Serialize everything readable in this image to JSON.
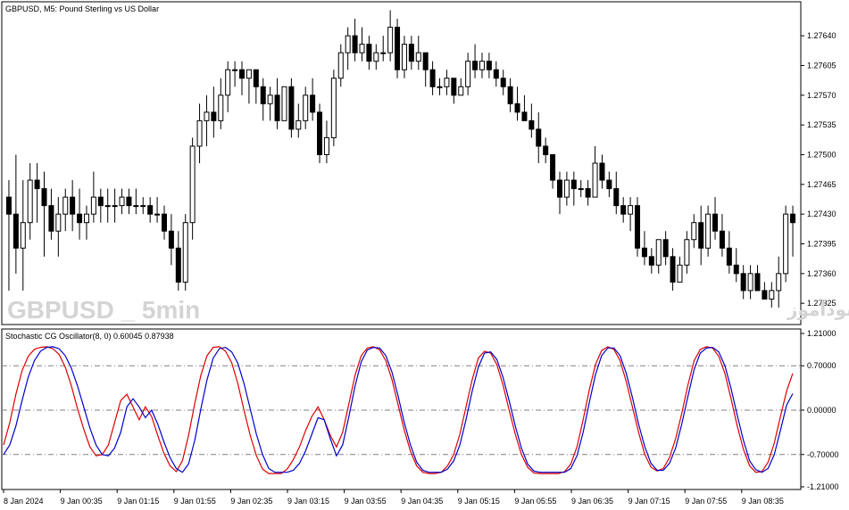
{
  "main_chart": {
    "title": "GBPUSD, M5:  Pound Sterling vs US Dollar",
    "watermark_left": "GBPUSD _ 5min",
    "watermark_right": "انتشار در سایت سودآموز",
    "price_levels": [
      "1.27640",
      "1.27605",
      "1.27570",
      "1.27535",
      "1.27500",
      "1.27465",
      "1.27430",
      "1.27395",
      "1.27360",
      "1.27325"
    ]
  },
  "sub_chart": {
    "title": "Stochastic CG Oscillator(8, 0) 0.60045 0.87938",
    "levels": [
      "1.21000",
      "0.70000",
      "0.00000",
      "-0.70000",
      "-1.21000"
    ]
  },
  "time_axis": [
    "8 Jan 2024",
    "9 Jan 00:35",
    "9 Jan 01:15",
    "9 Jan 01:55",
    "9 Jan 02:35",
    "9 Jan 03:15",
    "9 Jan 03:55",
    "9 Jan 04:35",
    "9 Jan 05:15",
    "9 Jan 05:55",
    "9 Jan 06:35",
    "9 Jan 07:15",
    "9 Jan 07:55",
    "9 Jan 08:35"
  ],
  "chart_data": [
    {
      "type": "candlestick",
      "title": "GBPUSD, M5:  Pound Sterling vs US Dollar",
      "ylim": [
        1.273,
        1.2768
      ],
      "candles": [
        [
          1.2745,
          1.2747,
          1.2734,
          1.2743
        ],
        [
          1.2743,
          1.275,
          1.2736,
          1.2739
        ],
        [
          1.2739,
          1.2747,
          1.2734,
          1.2742
        ],
        [
          1.2742,
          1.2749,
          1.274,
          1.2747
        ],
        [
          1.2747,
          1.2749,
          1.2742,
          1.2746
        ],
        [
          1.2746,
          1.2748,
          1.2738,
          1.2744
        ],
        [
          1.2744,
          1.2746,
          1.274,
          1.2741
        ],
        [
          1.2741,
          1.2745,
          1.2738,
          1.2743
        ],
        [
          1.2743,
          1.2746,
          1.2741,
          1.2745
        ],
        [
          1.2745,
          1.2747,
          1.2741,
          1.2743
        ],
        [
          1.2743,
          1.2746,
          1.274,
          1.2742
        ],
        [
          1.2742,
          1.2744,
          1.274,
          1.2743
        ],
        [
          1.2743,
          1.2748,
          1.2742,
          1.2745
        ],
        [
          1.2745,
          1.2746,
          1.2742,
          1.2744
        ],
        [
          1.2744,
          1.2746,
          1.2742,
          1.2744
        ],
        [
          1.2744,
          1.2746,
          1.2742,
          1.2744
        ],
        [
          1.2744,
          1.2746,
          1.2743,
          1.2745
        ],
        [
          1.2745,
          1.2746,
          1.2743,
          1.2744
        ],
        [
          1.2744,
          1.2746,
          1.2743,
          1.2744
        ],
        [
          1.2744,
          1.2745,
          1.2743,
          1.2744
        ],
        [
          1.2744,
          1.2745,
          1.2742,
          1.2743
        ],
        [
          1.2743,
          1.2745,
          1.2742,
          1.2743
        ],
        [
          1.2743,
          1.2744,
          1.274,
          1.2741
        ],
        [
          1.2741,
          1.2743,
          1.2737,
          1.2739
        ],
        [
          1.2739,
          1.2741,
          1.2734,
          1.2735
        ],
        [
          1.2735,
          1.2743,
          1.2734,
          1.2742
        ],
        [
          1.2742,
          1.2752,
          1.274,
          1.2751
        ],
        [
          1.2751,
          1.2756,
          1.2749,
          1.2754
        ],
        [
          1.2754,
          1.2757,
          1.2751,
          1.2755
        ],
        [
          1.2755,
          1.2758,
          1.2752,
          1.2754
        ],
        [
          1.2754,
          1.2759,
          1.2753,
          1.2757
        ],
        [
          1.2757,
          1.2761,
          1.2755,
          1.276
        ],
        [
          1.276,
          1.2761,
          1.2758,
          1.276
        ],
        [
          1.276,
          1.2761,
          1.2757,
          1.2759
        ],
        [
          1.2759,
          1.276,
          1.2756,
          1.276
        ],
        [
          1.276,
          1.276,
          1.2756,
          1.2758
        ],
        [
          1.2758,
          1.2759,
          1.2754,
          1.2756
        ],
        [
          1.2756,
          1.2758,
          1.2754,
          1.2757
        ],
        [
          1.2757,
          1.2759,
          1.2753,
          1.2754
        ],
        [
          1.2754,
          1.2758,
          1.2754,
          1.2758
        ],
        [
          1.2758,
          1.2759,
          1.2752,
          1.2753
        ],
        [
          1.2753,
          1.2756,
          1.2752,
          1.2754
        ],
        [
          1.2754,
          1.2758,
          1.2753,
          1.2757
        ],
        [
          1.2757,
          1.2759,
          1.2754,
          1.2755
        ],
        [
          1.2755,
          1.2756,
          1.2749,
          1.275
        ],
        [
          1.275,
          1.2754,
          1.2749,
          1.2752
        ],
        [
          1.2752,
          1.276,
          1.2751,
          1.2759
        ],
        [
          1.2759,
          1.2763,
          1.2758,
          1.2762
        ],
        [
          1.2762,
          1.2765,
          1.276,
          1.2764
        ],
        [
          1.2764,
          1.2766,
          1.2761,
          1.2762
        ],
        [
          1.2762,
          1.2765,
          1.2761,
          1.2763
        ],
        [
          1.2763,
          1.2764,
          1.276,
          1.2761
        ],
        [
          1.2761,
          1.2763,
          1.276,
          1.2762
        ],
        [
          1.2762,
          1.2764,
          1.2761,
          1.2762
        ],
        [
          1.2762,
          1.2767,
          1.2761,
          1.2765
        ],
        [
          1.2765,
          1.2766,
          1.2759,
          1.276
        ],
        [
          1.276,
          1.2764,
          1.2759,
          1.2763
        ],
        [
          1.2763,
          1.2764,
          1.276,
          1.2761
        ],
        [
          1.2761,
          1.2764,
          1.276,
          1.2762
        ],
        [
          1.2762,
          1.2762,
          1.2758,
          1.276
        ],
        [
          1.276,
          1.2761,
          1.2757,
          1.2758
        ],
        [
          1.2758,
          1.2759,
          1.2757,
          1.2758
        ],
        [
          1.2758,
          1.276,
          1.2757,
          1.2759
        ],
        [
          1.2759,
          1.2759,
          1.2756,
          1.2757
        ],
        [
          1.2757,
          1.2759,
          1.2757,
          1.2758
        ],
        [
          1.2758,
          1.2762,
          1.2757,
          1.2761
        ],
        [
          1.2761,
          1.2763,
          1.2759,
          1.276
        ],
        [
          1.276,
          1.2762,
          1.2759,
          1.2761
        ],
        [
          1.2761,
          1.2762,
          1.2759,
          1.276
        ],
        [
          1.276,
          1.2761,
          1.2758,
          1.2759
        ],
        [
          1.2759,
          1.276,
          1.2757,
          1.2758
        ],
        [
          1.2758,
          1.2759,
          1.2755,
          1.2756
        ],
        [
          1.2756,
          1.2758,
          1.2754,
          1.2755
        ],
        [
          1.2755,
          1.2757,
          1.2754,
          1.2754
        ],
        [
          1.2754,
          1.2756,
          1.2752,
          1.2753
        ],
        [
          1.2753,
          1.2755,
          1.2749,
          1.2751
        ],
        [
          1.2751,
          1.2752,
          1.2749,
          1.275
        ],
        [
          1.275,
          1.275,
          1.2746,
          1.2747
        ],
        [
          1.2747,
          1.2748,
          1.2743,
          1.2745
        ],
        [
          1.2745,
          1.2748,
          1.2744,
          1.2747
        ],
        [
          1.2747,
          1.2748,
          1.2744,
          1.2746
        ],
        [
          1.2746,
          1.2747,
          1.2745,
          1.2746
        ],
        [
          1.2746,
          1.2747,
          1.2744,
          1.2745
        ],
        [
          1.2745,
          1.2751,
          1.2745,
          1.2749
        ],
        [
          1.2749,
          1.275,
          1.2746,
          1.2747
        ],
        [
          1.2747,
          1.2748,
          1.2745,
          1.2746
        ],
        [
          1.2746,
          1.2748,
          1.2743,
          1.2744
        ],
        [
          1.2744,
          1.2745,
          1.2742,
          1.2743
        ],
        [
          1.2743,
          1.2745,
          1.2741,
          1.2744
        ],
        [
          1.2744,
          1.2745,
          1.2738,
          1.2739
        ],
        [
          1.2739,
          1.2741,
          1.2737,
          1.2738
        ],
        [
          1.2738,
          1.2739,
          1.2736,
          1.2737
        ],
        [
          1.2737,
          1.274,
          1.2736,
          1.274
        ],
        [
          1.274,
          1.2741,
          1.2737,
          1.2738
        ],
        [
          1.2738,
          1.2739,
          1.2734,
          1.2735
        ],
        [
          1.2735,
          1.2738,
          1.2735,
          1.2737
        ],
        [
          1.2737,
          1.2741,
          1.2736,
          1.274
        ],
        [
          1.274,
          1.2743,
          1.2739,
          1.2742
        ],
        [
          1.2742,
          1.2744,
          1.2737,
          1.2739
        ],
        [
          1.2739,
          1.2744,
          1.2738,
          1.2743
        ],
        [
          1.2743,
          1.2745,
          1.274,
          1.2741
        ],
        [
          1.2741,
          1.2743,
          1.2738,
          1.2739
        ],
        [
          1.2739,
          1.2741,
          1.2736,
          1.2737
        ],
        [
          1.2737,
          1.2739,
          1.2735,
          1.2736
        ],
        [
          1.2736,
          1.2737,
          1.2733,
          1.2734
        ],
        [
          1.2734,
          1.2737,
          1.2733,
          1.2736
        ],
        [
          1.2736,
          1.2737,
          1.2734,
          1.2734
        ],
        [
          1.2734,
          1.2735,
          1.2733,
          1.2733
        ],
        [
          1.2733,
          1.2735,
          1.2732,
          1.2734
        ],
        [
          1.2734,
          1.2738,
          1.2732,
          1.2736
        ],
        [
          1.2736,
          1.2744,
          1.2735,
          1.2743
        ],
        [
          1.2743,
          1.2744,
          1.2738,
          1.2742
        ]
      ]
    },
    {
      "type": "line",
      "title": "Stochastic CG Oscillator(8, 0) 0.60045 0.87938",
      "ylim": [
        -1.21,
        1.21
      ],
      "levels": [
        0.7,
        0.0,
        -0.7
      ],
      "series": [
        {
          "color": "#dd0000",
          "shape": [
            -0.55,
            -0.2,
            0.25,
            0.62,
            0.85,
            0.96,
            0.99,
            1.0,
            0.97,
            0.88,
            0.68,
            0.38,
            0.02,
            -0.3,
            -0.58,
            -0.72,
            -0.7,
            -0.55,
            -0.2,
            0.15,
            0.25,
            0.05,
            -0.15,
            0.05,
            -0.1,
            -0.4,
            -0.68,
            -0.88,
            -0.97,
            -0.8,
            -0.4,
            0.1,
            0.55,
            0.86,
            0.99,
            1.0,
            0.93,
            0.75,
            0.42,
            0.0,
            -0.4,
            -0.72,
            -0.93,
            -1.0,
            -1.0,
            -1.0,
            -0.93,
            -0.78,
            -0.58,
            -0.32,
            -0.1,
            0.05,
            -0.15,
            -0.4,
            -0.58,
            -0.35,
            0.1,
            0.55,
            0.86,
            0.98,
            1.0,
            0.95,
            0.78,
            0.48,
            0.08,
            -0.32,
            -0.65,
            -0.88,
            -0.98,
            -1.0,
            -1.0,
            -0.98,
            -0.88,
            -0.7,
            -0.38,
            0.05,
            0.48,
            0.82,
            0.93,
            0.9,
            0.72,
            0.4,
            0.0,
            -0.38,
            -0.7,
            -0.9,
            -0.99,
            -1.0,
            -1.0,
            -1.0,
            -1.0,
            -0.97,
            -0.85,
            -0.58,
            -0.15,
            0.32,
            0.72,
            0.94,
            1.0,
            0.96,
            0.78,
            0.45,
            0.05,
            -0.35,
            -0.7,
            -0.9,
            -0.96,
            -0.92,
            -0.75,
            -0.45,
            -0.05,
            0.4,
            0.78,
            0.96,
            1.0,
            0.98,
            0.85,
            0.58,
            0.18,
            -0.25,
            -0.62,
            -0.88,
            -0.98,
            -0.97,
            -0.82,
            -0.52,
            -0.1,
            0.3,
            0.58
          ]
        },
        {
          "color": "#0000cc",
          "shape": [
            -0.7,
            -0.55,
            -0.25,
            0.15,
            0.52,
            0.78,
            0.93,
            0.99,
            1.0,
            0.97,
            0.86,
            0.66,
            0.38,
            0.05,
            -0.28,
            -0.55,
            -0.7,
            -0.72,
            -0.6,
            -0.35,
            0.05,
            0.18,
            0.05,
            -0.12,
            0.0,
            -0.22,
            -0.5,
            -0.75,
            -0.92,
            -0.98,
            -0.85,
            -0.48,
            0.02,
            0.48,
            0.82,
            0.97,
            0.99,
            0.92,
            0.74,
            0.42,
            0.02,
            -0.38,
            -0.7,
            -0.92,
            -0.98,
            -0.98,
            -0.98,
            -0.95,
            -0.84,
            -0.64,
            -0.38,
            -0.12,
            -0.15,
            -0.45,
            -0.72,
            -0.55,
            -0.1,
            0.38,
            0.76,
            0.95,
            0.99,
            0.98,
            0.86,
            0.6,
            0.22,
            -0.2,
            -0.55,
            -0.82,
            -0.95,
            -0.98,
            -0.98,
            -0.98,
            -0.93,
            -0.8,
            -0.55,
            -0.15,
            0.3,
            0.68,
            0.9,
            0.92,
            0.8,
            0.52,
            0.15,
            -0.25,
            -0.6,
            -0.85,
            -0.96,
            -0.98,
            -0.98,
            -0.98,
            -0.98,
            -0.98,
            -0.92,
            -0.72,
            -0.35,
            0.12,
            0.56,
            0.86,
            0.98,
            0.98,
            0.86,
            0.58,
            0.2,
            -0.22,
            -0.58,
            -0.84,
            -0.95,
            -0.95,
            -0.84,
            -0.6,
            -0.22,
            0.22,
            0.64,
            0.9,
            0.98,
            0.99,
            0.92,
            0.7,
            0.34,
            -0.08,
            -0.48,
            -0.8,
            -0.94,
            -0.98,
            -0.92,
            -0.7,
            -0.32,
            0.08,
            0.26
          ]
        }
      ]
    }
  ]
}
